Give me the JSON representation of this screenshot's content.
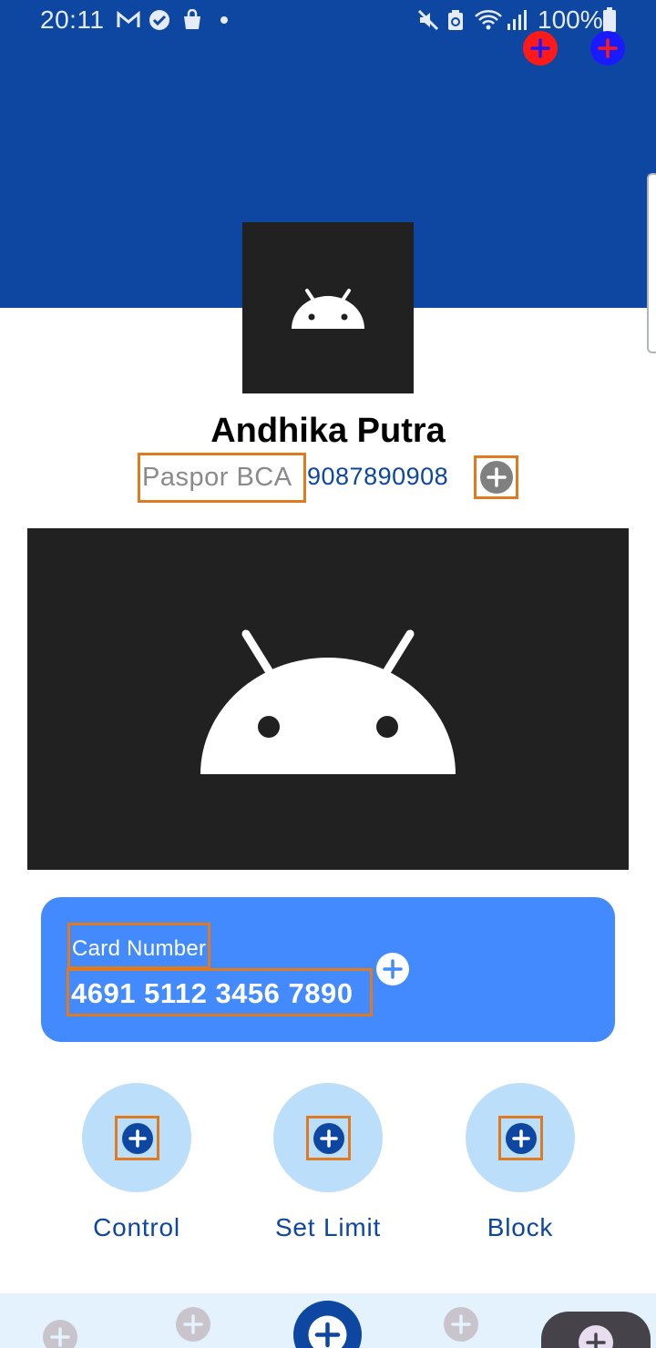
{
  "status_bar": {
    "time": "20:11",
    "battery": "100%",
    "icons": [
      "gmail-icon",
      "check-circle-icon",
      "shopping-bag-icon",
      "dot-icon",
      "mute-icon",
      "recycle-battery-icon",
      "wifi-icon",
      "signal-icon",
      "battery-icon"
    ]
  },
  "header": {
    "background_color": "#0d47a1",
    "add_buttons": [
      "red-add-icon",
      "blue-add-icon"
    ]
  },
  "profile": {
    "name": "Andhika Putra",
    "id_type": "Paspor BCA",
    "id_number": "9087890908",
    "copy_icon": "add-circle-icon"
  },
  "card": {
    "label": "Card Number",
    "number": "4691 5112 3456 7890",
    "color": "#448aff"
  },
  "actions": [
    {
      "label": "Control",
      "icon": "add-circle-icon"
    },
    {
      "label": "Set Limit",
      "icon": "add-circle-icon"
    },
    {
      "label": "Block",
      "icon": "add-circle-icon"
    }
  ],
  "bottom_nav": {
    "items": [
      "add-circle-icon",
      "add-circle-icon",
      "add-circle-icon",
      "add-circle-icon",
      "add-circle-icon"
    ]
  }
}
